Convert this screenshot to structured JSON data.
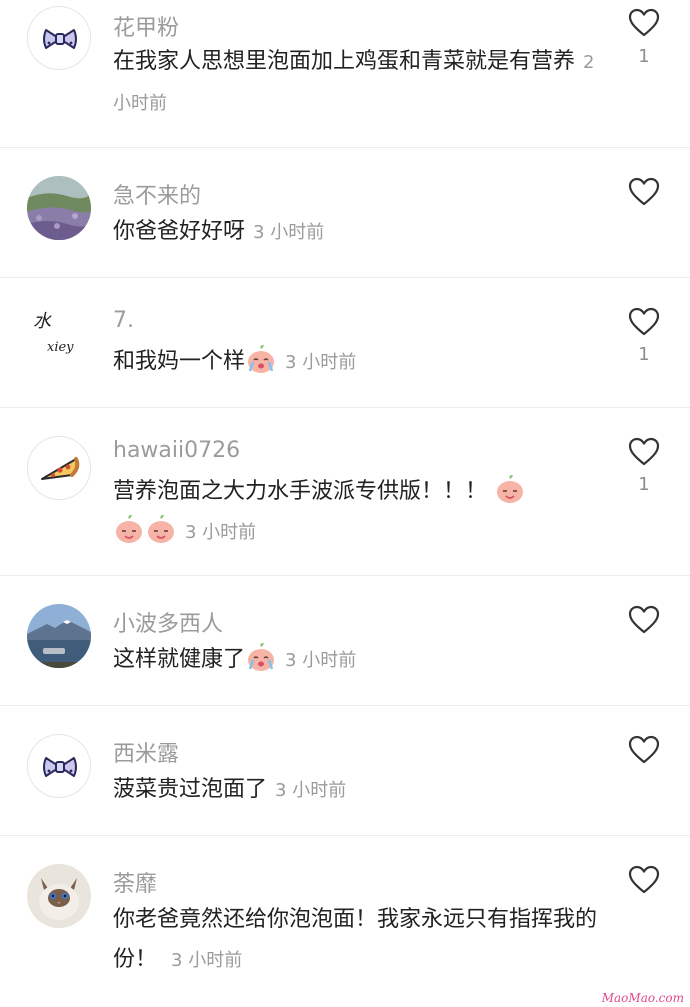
{
  "comments": [
    {
      "user": "花甲粉",
      "avatar_icon": "bow-icon",
      "text": "在我家人思想里泡面加上鸡蛋和青菜就是有营养",
      "time": "2 小时前",
      "likes": "1"
    },
    {
      "user": "急不来的",
      "avatar_icon": "lavender-field-photo",
      "text": "你爸爸好好呀",
      "time": "3 小时前",
      "likes": ""
    },
    {
      "user": "7.",
      "avatar_icon": "handwriting-scribble",
      "text": "和我妈一个样",
      "emoji": "crying-peach-emoji",
      "time": "3 小时前",
      "likes": "1"
    },
    {
      "user": "hawaii0726",
      "avatar_icon": "pizza-slice-icon",
      "text": "营养泡面之大力水手波派专供版！！！",
      "emoji": "peach-emoji",
      "time": "3 小时前",
      "likes": "1"
    },
    {
      "user": "小波多西人",
      "avatar_icon": "lake-mountain-photo",
      "text": "这样就健康了",
      "emoji": "crying-peach-emoji",
      "time": "3 小时前",
      "likes": ""
    },
    {
      "user": "西米露",
      "avatar_icon": "bow-icon",
      "text": "菠菜贵过泡面了",
      "time": "3 小时前",
      "likes": ""
    },
    {
      "user": "荼靡",
      "avatar_icon": "cat-photo",
      "text": "你老爸竟然还给你泡泡面！我家永远只有指挥我的份！",
      "time": "3 小时前",
      "likes": ""
    }
  ],
  "avatar_handwriting": [
    "水",
    "xiey"
  ],
  "watermark": "MaoMao.com",
  "colors": {
    "username": "#9b9b9b",
    "text": "#222222",
    "divider": "#ececec",
    "peach": "#f7b3a6",
    "leaf": "#7cc46a"
  }
}
